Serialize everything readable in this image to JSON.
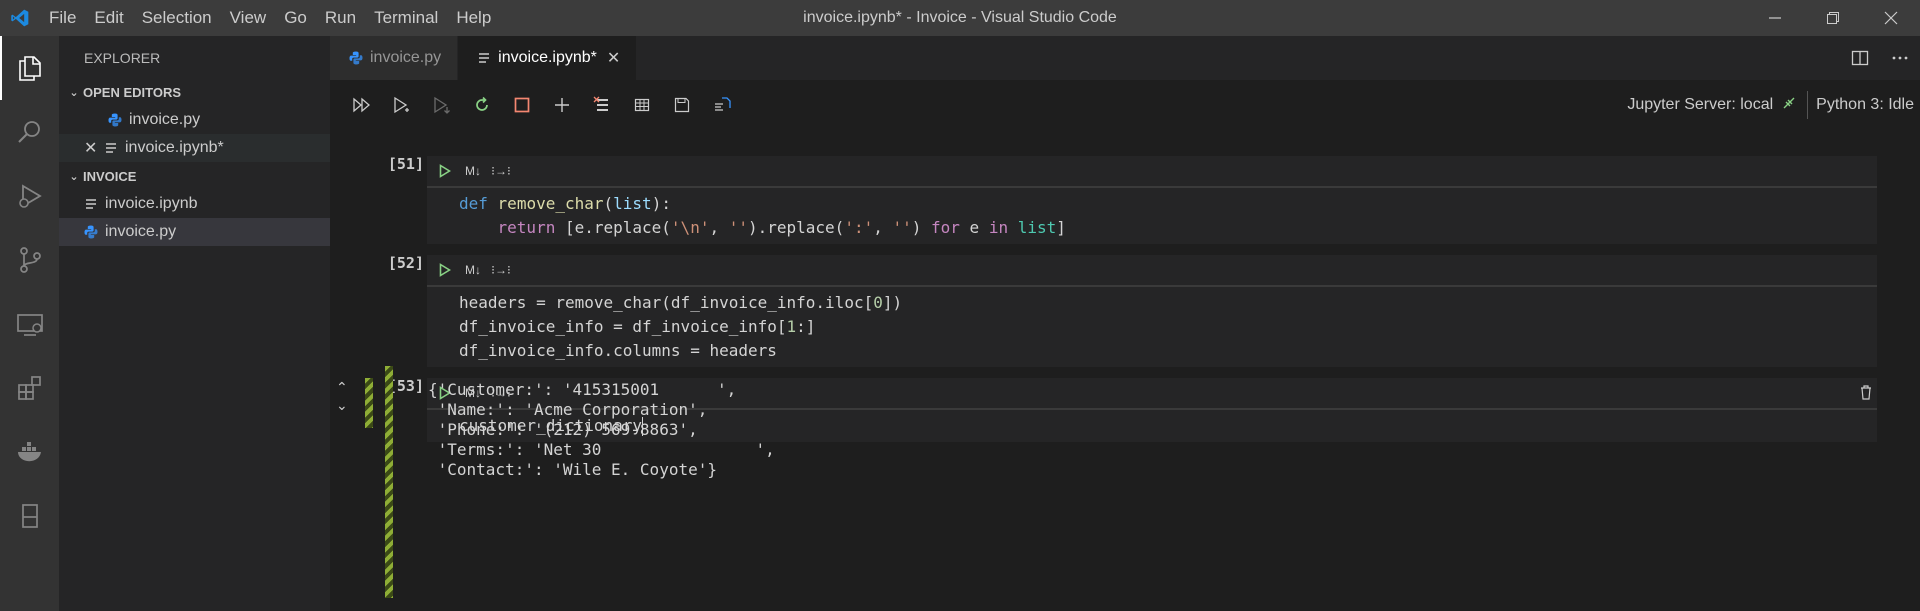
{
  "window": {
    "title": "invoice.ipynb* - Invoice - Visual Studio Code"
  },
  "menu": [
    "File",
    "Edit",
    "Selection",
    "View",
    "Go",
    "Run",
    "Terminal",
    "Help"
  ],
  "sidebar": {
    "title": "EXPLORER",
    "open_editors": {
      "label": "OPEN EDITORS",
      "files": [
        "invoice.py",
        "invoice.ipynb*"
      ]
    },
    "workspace": {
      "label": "INVOICE",
      "files": [
        "invoice.ipynb",
        "invoice.py"
      ]
    }
  },
  "tabs": [
    {
      "label": "invoice.py",
      "icon": "python-file-icon"
    },
    {
      "label": "invoice.ipynb*",
      "icon": "notebook-file-icon"
    }
  ],
  "toolbar": {
    "server": "Jupyter Server: local",
    "kernel": "Python 3: Idle"
  },
  "cells": [
    {
      "number": "[51]",
      "lines": [
        "def remove_char(list):",
        "    return [e.replace('\\n', '').replace(':', '') for e in list]"
      ]
    },
    {
      "number": "[52]",
      "lines": [
        "headers = remove_char(df_invoice_info.iloc[0])",
        "df_invoice_info = df_invoice_info[1:]",
        "df_invoice_info.columns = headers"
      ]
    },
    {
      "number": "[53]",
      "lines": [
        "customer_dictionary"
      ]
    }
  ],
  "output": {
    "lines": [
      "{'Customer:': '415315001      ',",
      " 'Name:': 'Acme Corporation',",
      " 'Phone:': '(212) 569-8863',",
      " 'Terms:': 'Net 30                ',",
      " 'Contact:': 'Wile E. Coyote'}"
    ]
  },
  "colors": {
    "accent": "#007acc",
    "run": "#89d185",
    "stop": "#f48771",
    "python": "#3794ff"
  }
}
